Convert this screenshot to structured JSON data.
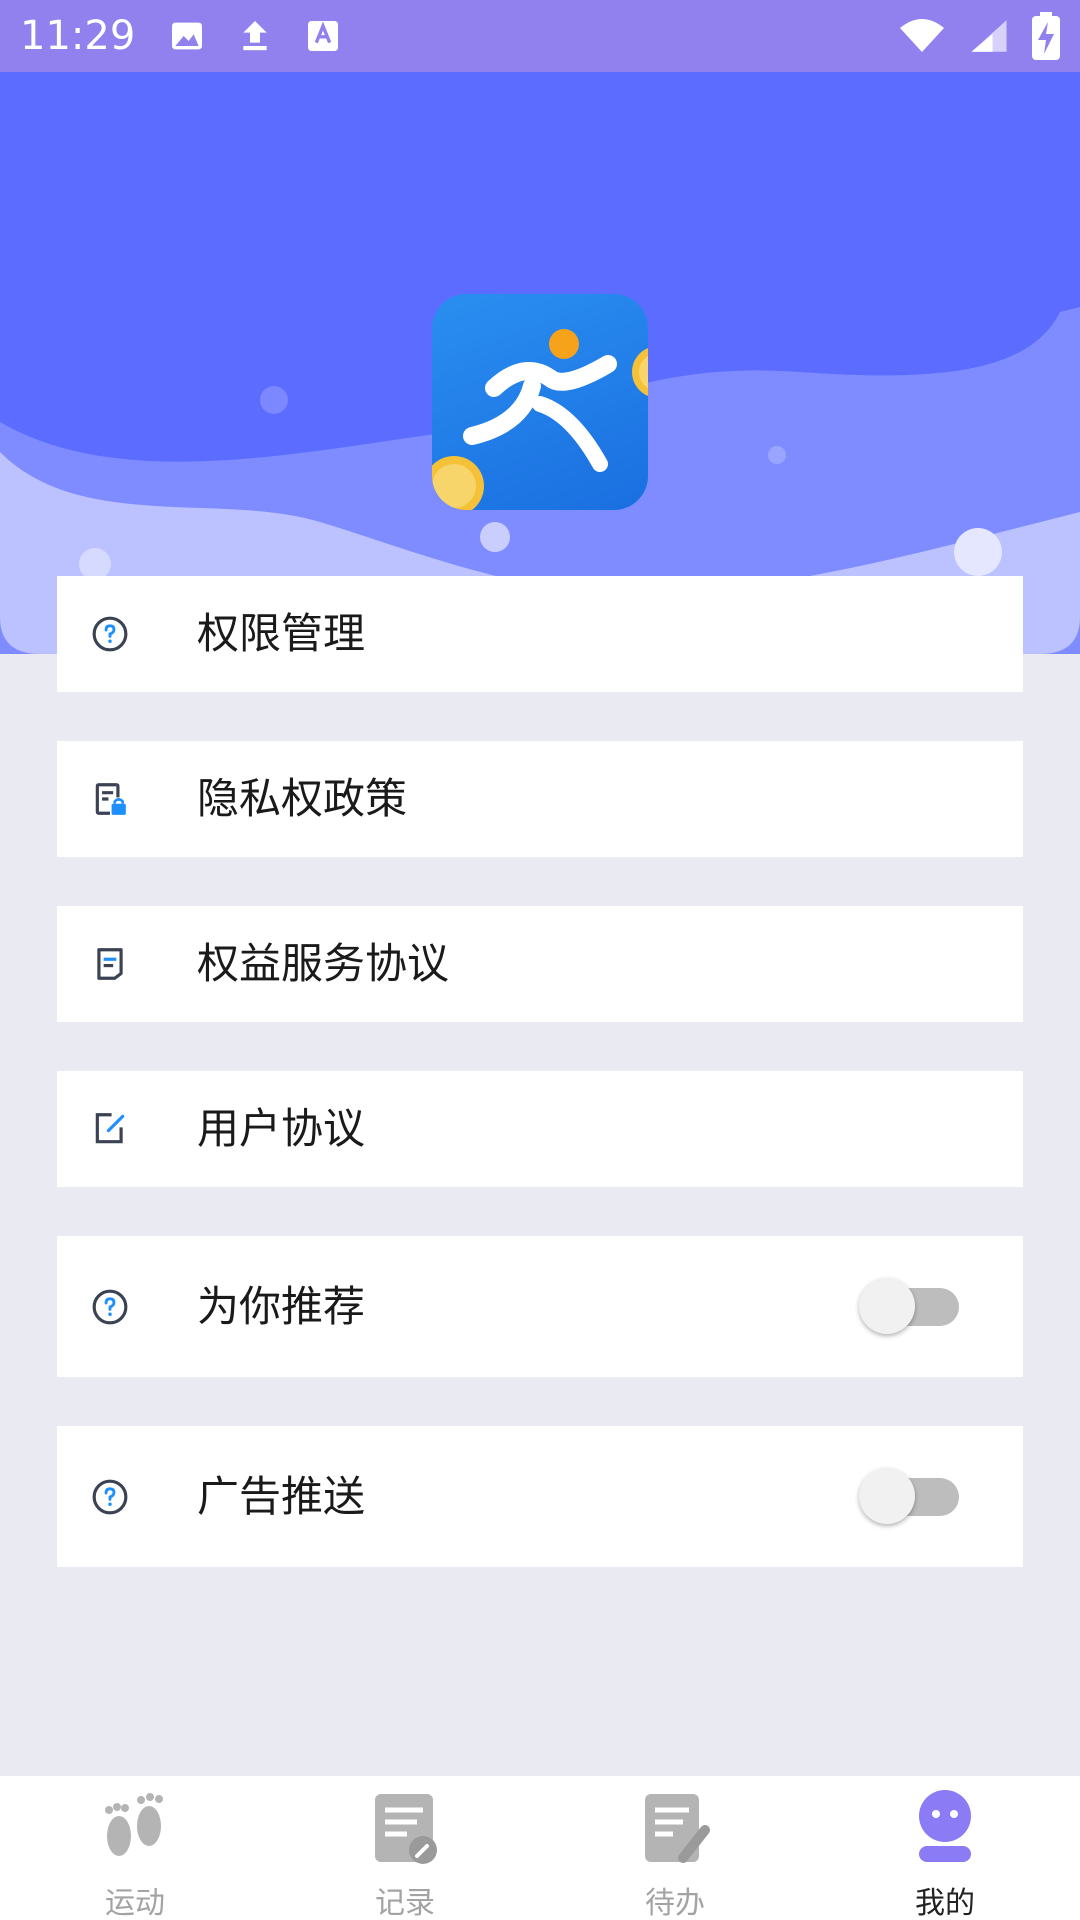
{
  "status_bar": {
    "time": "11:29",
    "left_icons": [
      "image-icon",
      "upload-icon",
      "text-recognition-icon"
    ],
    "right_icons": [
      "wifi-icon",
      "cell-signal-icon",
      "battery-charging-icon"
    ]
  },
  "header": {
    "colors": {
      "top": "#5b6cff",
      "wave": "#8e98ff",
      "light_wave": "#bcc2ff"
    },
    "logo_icon": "running-man-coins-icon"
  },
  "menu": {
    "items": [
      {
        "label": "权限管理",
        "icon": "question-circle-icon",
        "has_toggle": false
      },
      {
        "label": "隐私权政策",
        "icon": "privacy-lock-icon",
        "has_toggle": false
      },
      {
        "label": "权益服务协议",
        "icon": "document-icon",
        "has_toggle": false
      },
      {
        "label": "用户协议",
        "icon": "edit-icon",
        "has_toggle": false
      },
      {
        "label": "为你推荐",
        "icon": "question-circle-icon",
        "has_toggle": true,
        "toggle_on": false
      },
      {
        "label": "广告推送",
        "icon": "question-circle-icon",
        "has_toggle": true,
        "toggle_on": false
      }
    ]
  },
  "bottom_nav": {
    "items": [
      {
        "label": "运动",
        "icon": "footprints-icon",
        "active": false
      },
      {
        "label": "记录",
        "icon": "record-icon",
        "active": false
      },
      {
        "label": "待办",
        "icon": "todo-icon",
        "active": false
      },
      {
        "label": "我的",
        "icon": "profile-icon",
        "active": true
      }
    ],
    "active_color": "#8b7cf6",
    "inactive_color": "#a3a3a3"
  }
}
